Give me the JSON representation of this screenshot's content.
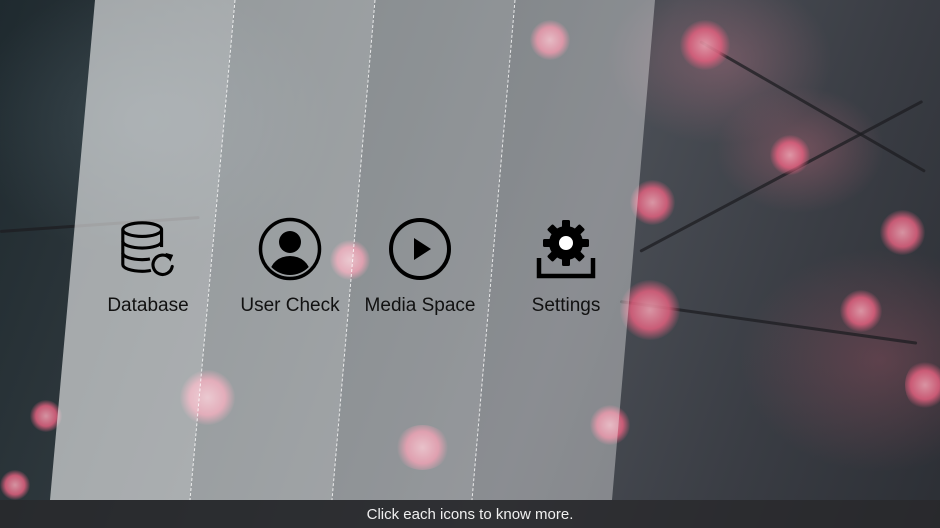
{
  "menu": {
    "items": [
      {
        "label": "Database",
        "icon": "database-refresh-icon"
      },
      {
        "label": "User Check",
        "icon": "user-circle-icon"
      },
      {
        "label": "Media Space",
        "icon": "play-circle-icon"
      },
      {
        "label": "Settings",
        "icon": "gear-download-icon"
      }
    ]
  },
  "footer": {
    "hint": "Click each icons to know more."
  },
  "colors": {
    "icon": "#000000",
    "panel_overlay": "#ffffff",
    "blossom": "#e0607e",
    "footer_bg": "#28282a"
  }
}
